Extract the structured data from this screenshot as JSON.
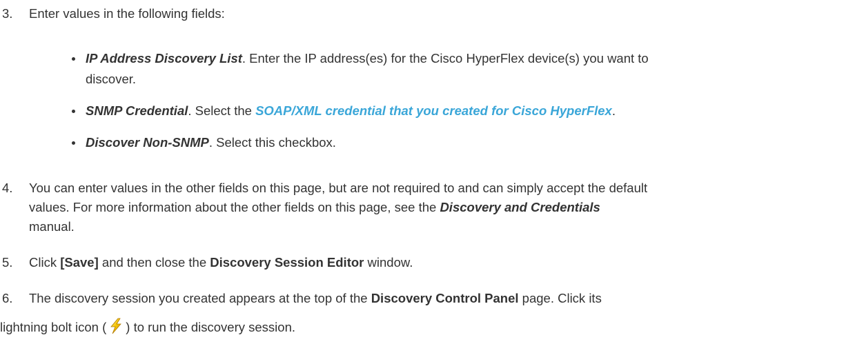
{
  "steps": [
    {
      "num": "3.",
      "text": "Enter values in the following fields:"
    },
    {
      "num": "4.",
      "line1": "You can enter values in the other fields on this page, but are not required to and can simply accept the default",
      "line2a": "values. For more information about the other fields on this page, see the ",
      "line2_bold": "Discovery and Credentials",
      "line3": "manual."
    },
    {
      "num": "5.",
      "a": "Click ",
      "bold1": "[Save]",
      "b": " and then close the ",
      "bold2": "Discovery Session Editor",
      "c": " window."
    },
    {
      "num": "6.",
      "a": "The discovery session you created appears at the top of the ",
      "bold1": "Discovery Control Panel",
      "b": " page. Click its",
      "line2a": "lightning bolt icon (",
      "line2b": ") to run the discovery session."
    }
  ],
  "bullets": [
    {
      "label": "IP Address Discovery List",
      "line1": ". Enter the IP address(es) for the Cisco HyperFlex device(s) you want to",
      "line2": "discover."
    },
    {
      "label": "SNMP Credential",
      "pre": ". Select the ",
      "link": "SOAP/XML credential that you created for Cisco HyperFlex",
      "post": "."
    },
    {
      "label": "Discover Non-SNMP",
      "text": ". Select this checkbox."
    }
  ],
  "colors": {
    "text": "#333333",
    "link": "#3aa6d8"
  },
  "icons": {
    "bolt": "lightning-bolt-icon"
  }
}
